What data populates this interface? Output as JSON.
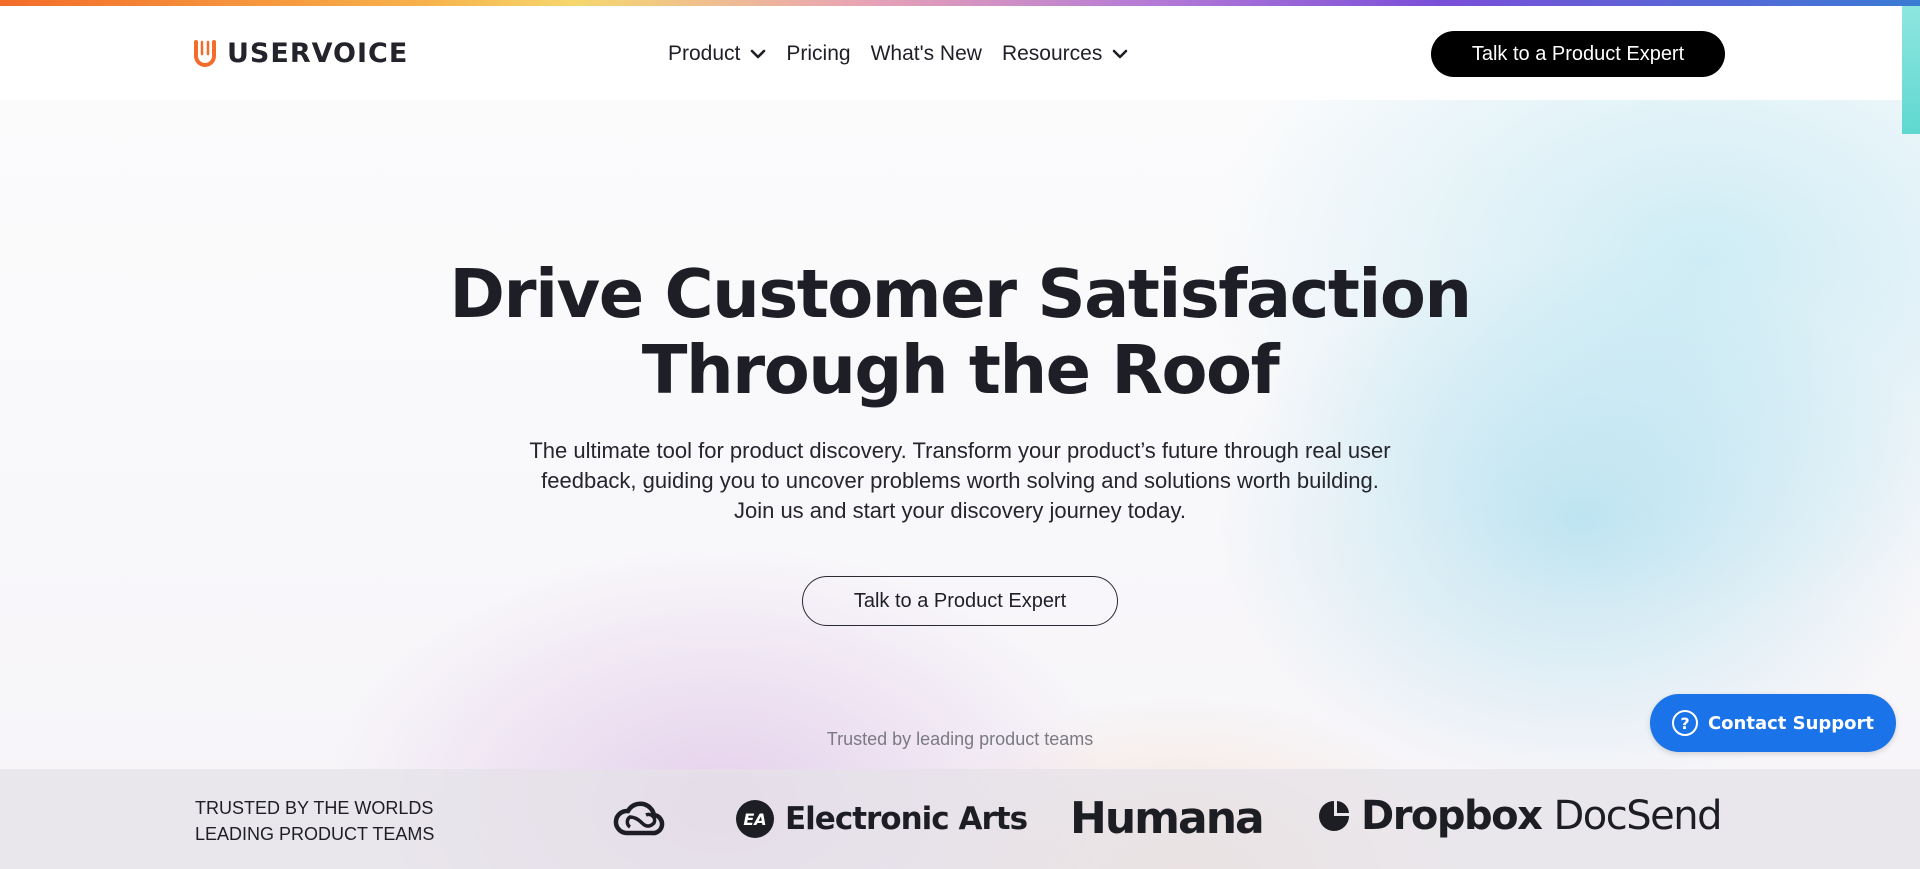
{
  "colors": {
    "accent_orange": "#f36c2a",
    "cta_black": "#000000",
    "support_blue": "#1a73e8",
    "text_dark": "#1e1e26"
  },
  "header": {
    "logo_text": "USERVOICE",
    "logo_icon": "uservoice-logo-icon",
    "nav": [
      {
        "label": "Product",
        "has_dropdown": true
      },
      {
        "label": "Pricing",
        "has_dropdown": false
      },
      {
        "label": "What's New",
        "has_dropdown": false
      },
      {
        "label": "Resources",
        "has_dropdown": true
      }
    ],
    "cta_label": "Talk to a Product Expert"
  },
  "hero": {
    "title_lines": [
      "Drive Customer Satisfaction",
      "Through the Roof"
    ],
    "subtitle_lines": [
      "The ultimate tool for product discovery. Transform your product’s future through real user",
      "feedback, guiding you to uncover problems worth solving and solutions worth building.",
      "Join us and start your discovery journey today."
    ],
    "cta_label": "Talk to a Product Expert",
    "trusted_caption": "Trusted by leading product teams"
  },
  "logo_strip": {
    "label_lines": [
      "TRUSTED BY THE WORLDS",
      "LEADING PRODUCT TEAMS"
    ],
    "brands": [
      {
        "name": "",
        "icon": "creative-cloud-icon"
      },
      {
        "name": "Electronic Arts",
        "icon": "ea-icon"
      },
      {
        "name": "Humana",
        "icon": ""
      },
      {
        "name": "Dropbox",
        "name2": "DocSend",
        "icon": "docsend-icon"
      }
    ]
  },
  "support": {
    "label": "Contact Support",
    "icon": "question-icon"
  }
}
